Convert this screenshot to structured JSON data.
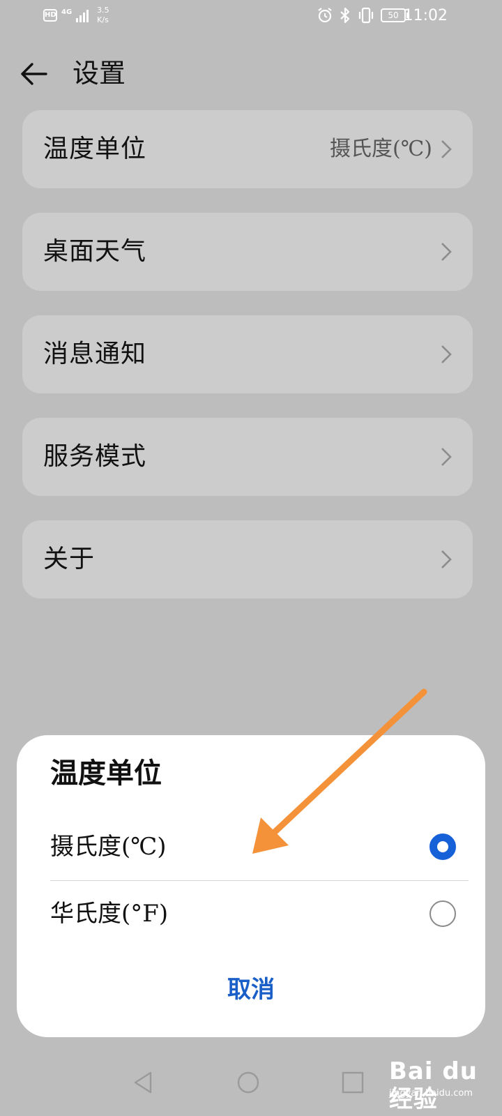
{
  "status_bar": {
    "hd_badge": "HD",
    "network_type": "4G",
    "net_speed_value": "3.5",
    "net_speed_unit": "K/s",
    "battery_level": "50",
    "time": "11:02",
    "icons": [
      "alarm-icon",
      "bluetooth-icon",
      "vibrate-icon",
      "battery-icon"
    ]
  },
  "header": {
    "back_icon": "arrow-left-icon",
    "title": "设置"
  },
  "settings": [
    {
      "label": "温度单位",
      "value": "摄氏度(℃)"
    },
    {
      "label": "桌面天气",
      "value": ""
    },
    {
      "label": "消息通知",
      "value": ""
    },
    {
      "label": "服务模式",
      "value": ""
    },
    {
      "label": "关于",
      "value": ""
    }
  ],
  "dialog": {
    "title": "温度单位",
    "options": [
      {
        "label": "摄氏度(℃)",
        "selected": true
      },
      {
        "label": "华氏度(°F)",
        "selected": false
      }
    ],
    "cancel_label": "取消"
  },
  "colors": {
    "accent": "#1660d8",
    "cancel_text": "#1a5fc8",
    "overlay_background": "#bdbdbe",
    "card_background": "#cccccc",
    "annotation_arrow": "#f4923a"
  },
  "nav_bar": {
    "icons": [
      "nav-back-icon",
      "nav-home-icon",
      "nav-recents-icon"
    ]
  },
  "watermark": {
    "brand": "Bai du 经验",
    "site": "jingyan.baidu.com"
  }
}
